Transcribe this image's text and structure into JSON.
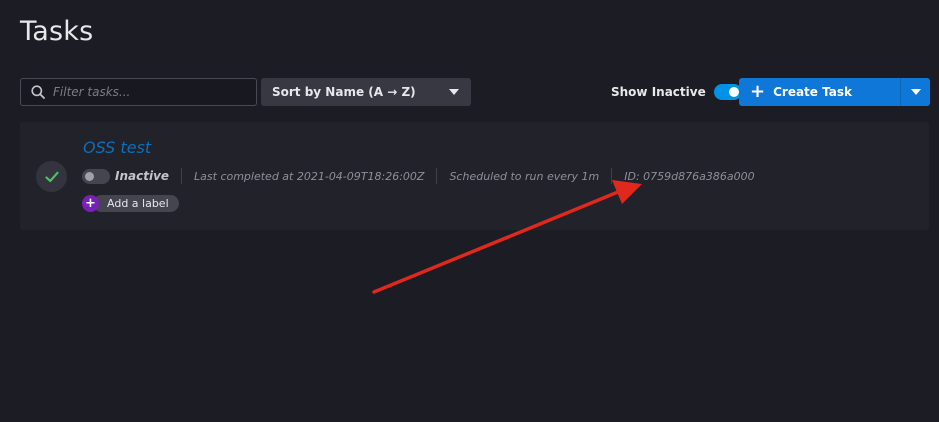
{
  "page": {
    "title": "Tasks"
  },
  "toolbar": {
    "search_placeholder": "Filter tasks...",
    "sort_label": "Sort by Name (A → Z)",
    "show_inactive_label": "Show Inactive",
    "show_inactive_on": true,
    "create_label": "Create Task"
  },
  "tasks": [
    {
      "name": "OSS test",
      "status": "Inactive",
      "last_completed": "Last completed at 2021-04-09T18:26:00Z",
      "schedule": "Scheduled to run every 1m",
      "id": "ID: 0759d876a386a000",
      "add_label": "Add a label",
      "completed": true
    }
  ],
  "colors": {
    "background": "#1c1c24",
    "card": "#22222b",
    "accent": "#0e77d8",
    "task_link": "#0e6fb8",
    "label_plus": "#7a1fb8",
    "success_check": "#4ec260",
    "annotation_arrow": "#e0281c"
  },
  "icons": {
    "search": "search-icon",
    "sort_caret": "chevron-down-icon",
    "create_plus": "plus-icon",
    "create_caret": "chevron-down-icon",
    "status": "check-icon",
    "add_label": "plus-icon"
  }
}
